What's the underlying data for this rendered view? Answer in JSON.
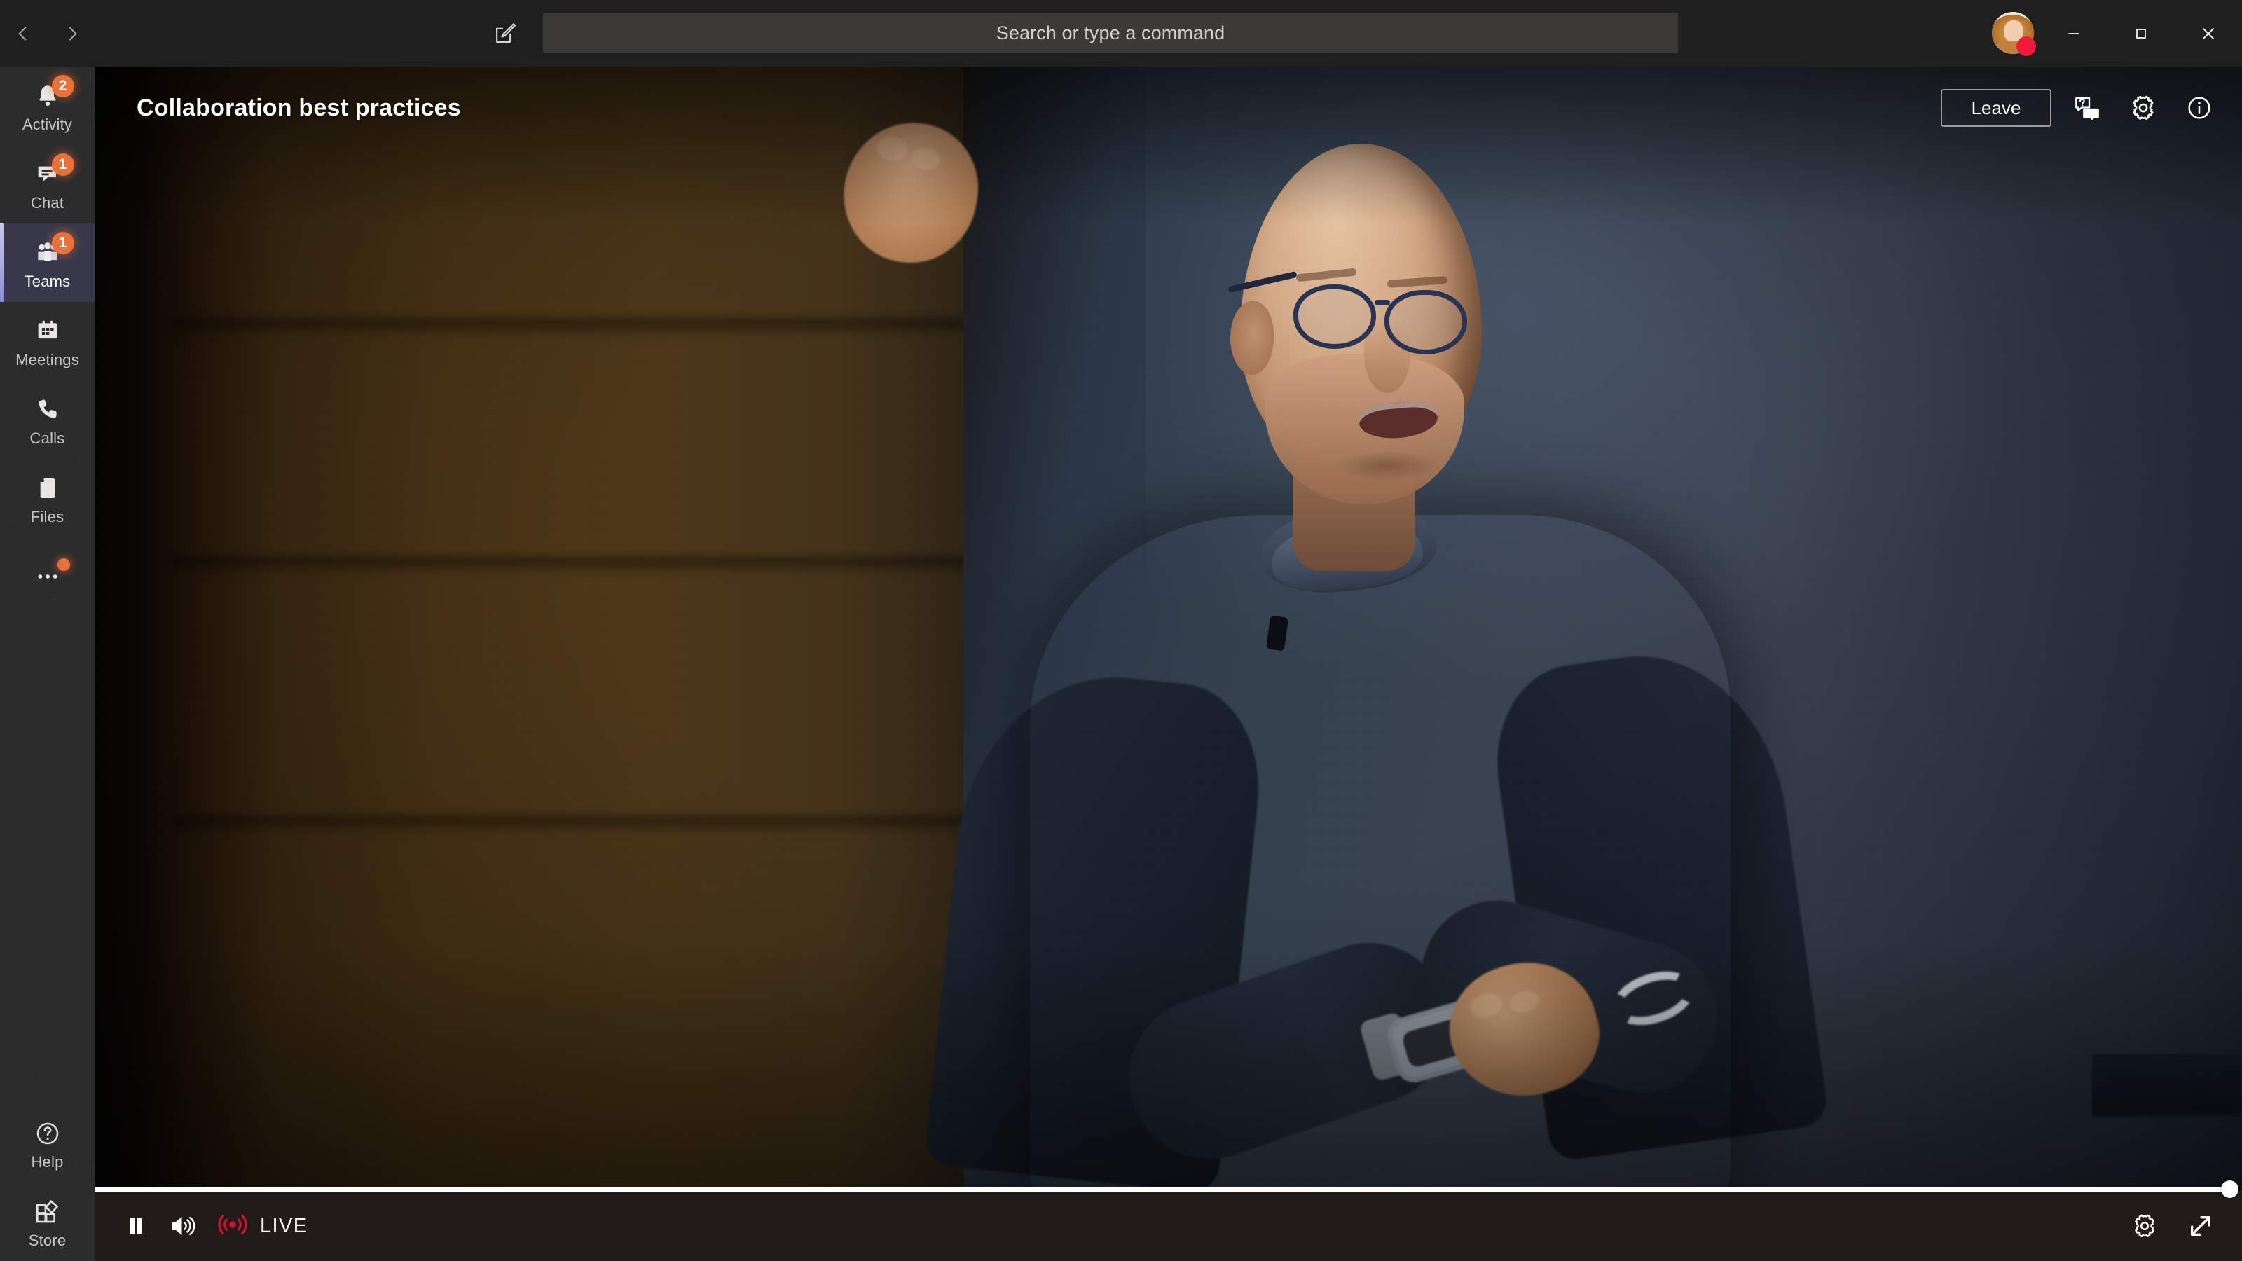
{
  "window": {
    "title": "Microsoft Teams",
    "nav": {
      "back_label": "Back",
      "forward_label": "Forward"
    },
    "controls": {
      "minimize_label": "Minimize",
      "maximize_label": "Maximize",
      "close_label": "Close"
    }
  },
  "topbar": {
    "compose_icon": "compose-new-chat-icon",
    "search": {
      "placeholder": "Search or type a command",
      "value": ""
    },
    "profile": {
      "status": "Do not disturb",
      "status_color": "#f01b38",
      "avatar_alt": "User profile photo"
    }
  },
  "sidebar": {
    "items": [
      {
        "label": "Activity",
        "icon": "bell-icon",
        "badge": "2",
        "active": false
      },
      {
        "label": "Chat",
        "icon": "chat-bubble-icon",
        "badge": "1",
        "active": false
      },
      {
        "label": "Teams",
        "icon": "people-icon",
        "badge": "1",
        "active": true
      },
      {
        "label": "Meetings",
        "icon": "calendar-icon",
        "badge": "",
        "active": false
      },
      {
        "label": "Calls",
        "icon": "phone-icon",
        "badge": "",
        "active": false
      },
      {
        "label": "Files",
        "icon": "file-icon",
        "badge": "",
        "active": false
      },
      {
        "label": "",
        "icon": "more-ellipsis-icon",
        "badge": "dot",
        "active": false
      }
    ],
    "bottom_items": [
      {
        "label": "Help",
        "icon": "question-circle-icon"
      },
      {
        "label": "Store",
        "icon": "store-grid-icon"
      }
    ],
    "badge_color": "#e8703a",
    "active_indicator_color": "#c8c6f0"
  },
  "stage": {
    "meeting_title": "Collaboration best practices",
    "actions": {
      "leave_label": "Leave",
      "qna_icon": "qna-question-bubble-icon",
      "settings_icon": "gear-icon",
      "info_icon": "info-circle-icon"
    },
    "video": {
      "description": "Live event video feed of a presenter speaking on stage",
      "backdrop_left_color": "#4a3415",
      "backdrop_right_color": "#3a4352"
    }
  },
  "player": {
    "play_pause_state": "pause",
    "play_pause_icon": "pause-icon",
    "volume_icon": "volume-high-icon",
    "live_icon": "live-broadcast-icon",
    "live_label": "LIVE",
    "live_color": "#d81030",
    "settings_icon": "gear-icon",
    "fullscreen_icon": "expand-diagonal-icon",
    "progress_percent": 100
  }
}
